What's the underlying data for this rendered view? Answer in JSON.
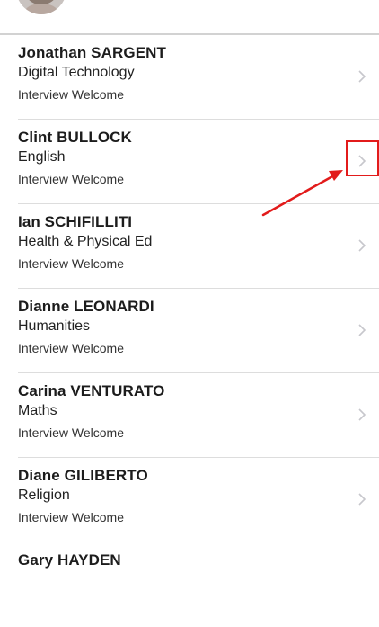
{
  "contacts": [
    {
      "name": "Jonathan SARGENT",
      "department": "Digital Technology",
      "status": "Interview Welcome"
    },
    {
      "name": "Clint BULLOCK",
      "department": "English",
      "status": "Interview Welcome"
    },
    {
      "name": "Ian SCHIFILLITI",
      "department": "Health & Physical Ed",
      "status": "Interview Welcome"
    },
    {
      "name": "Dianne LEONARDI",
      "department": "Humanities",
      "status": "Interview Welcome"
    },
    {
      "name": "Carina VENTURATO",
      "department": "Maths",
      "status": "Interview Welcome"
    },
    {
      "name": "Diane GILIBERTO",
      "department": "Religion",
      "status": "Interview Welcome"
    },
    {
      "name": "Gary HAYDEN",
      "department": "",
      "status": ""
    }
  ],
  "icons": {
    "row_disclosure": "chevron-right-icon"
  },
  "annotation": {
    "highlight_color": "#e21b1b"
  }
}
